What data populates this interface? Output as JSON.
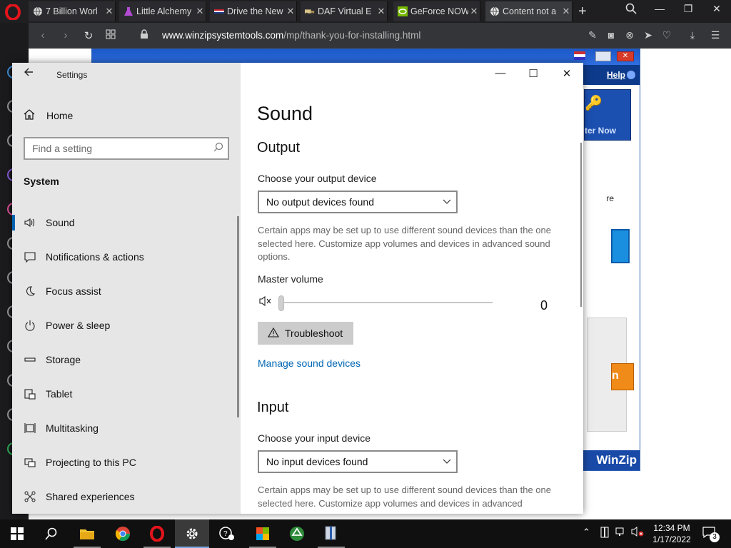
{
  "browser": {
    "tabs": [
      {
        "title": "7 Billion Worl",
        "favicon": "globe-icon"
      },
      {
        "title": "Little Alchemy",
        "favicon": "flask-icon"
      },
      {
        "title": "Drive the New",
        "favicon": "flag-icon"
      },
      {
        "title": "DAF Virtual E",
        "favicon": "truck-icon"
      },
      {
        "title": "GeForce NOW",
        "favicon": "nvidia-icon"
      },
      {
        "title": "Content not a",
        "favicon": "globe-icon",
        "active": true
      }
    ],
    "url_domain": "www.winzipsystemtools.com",
    "url_path": "/mp/thank-you-for-installing.html"
  },
  "webpage": {
    "help_label": "Help",
    "register_label": "ter Now",
    "body_text_fragment": "re",
    "orange_button_fragment": "n",
    "footer_brand": "WinZip"
  },
  "settings": {
    "app_title": "Settings",
    "home_label": "Home",
    "search_placeholder": "Find a setting",
    "section_label": "System",
    "nav": [
      {
        "label": "Sound",
        "icon": "speaker-icon",
        "selected": true
      },
      {
        "label": "Notifications & actions",
        "icon": "notification-icon"
      },
      {
        "label": "Focus assist",
        "icon": "moon-icon"
      },
      {
        "label": "Power & sleep",
        "icon": "power-icon"
      },
      {
        "label": "Storage",
        "icon": "storage-icon"
      },
      {
        "label": "Tablet",
        "icon": "tablet-icon"
      },
      {
        "label": "Multitasking",
        "icon": "multitasking-icon"
      },
      {
        "label": "Projecting to this PC",
        "icon": "projector-icon"
      },
      {
        "label": "Shared experiences",
        "icon": "share-icon"
      }
    ],
    "page_title": "Sound",
    "output": {
      "heading": "Output",
      "device_label": "Choose your output device",
      "device_value": "No output devices found",
      "description": "Certain apps may be set up to use different sound devices than the one selected here. Customize app volumes and devices in advanced sound options.",
      "volume_label": "Master volume",
      "volume_value": "0",
      "troubleshoot_label": "Troubleshoot",
      "manage_link": "Manage sound devices"
    },
    "input": {
      "heading": "Input",
      "device_label": "Choose your input device",
      "device_value": "No input devices found",
      "description": "Certain apps may be set up to use different sound devices than the one selected here. Customize app volumes and devices in advanced"
    }
  },
  "taskbar": {
    "time": "12:34 PM",
    "date": "1/17/2022",
    "notification_count": "3"
  },
  "colors": {
    "accent": "#0063b1",
    "link": "#0066b4",
    "sidebar_bg": "#e6e6e6",
    "browser_dark": "#1f1f22"
  }
}
